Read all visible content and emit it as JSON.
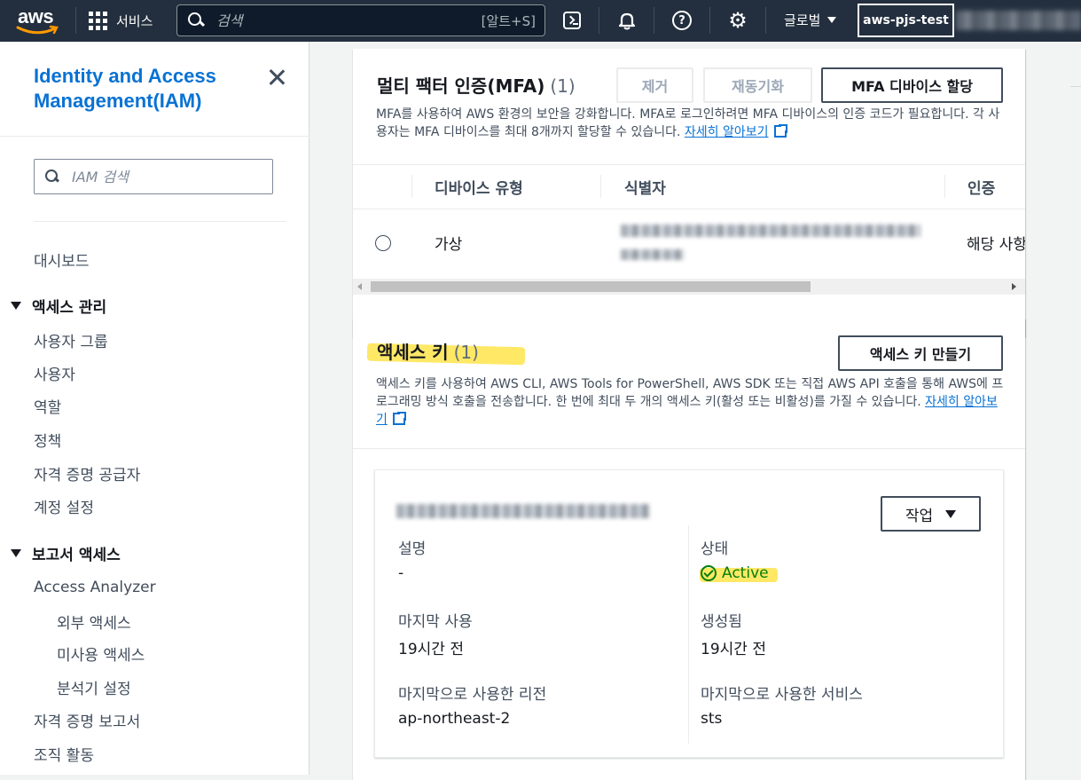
{
  "topbar": {
    "logo": "aws",
    "services_label": "서비스",
    "search_placeholder": "검색",
    "search_shortcut": "[알트+S]",
    "region_label": "글로벌",
    "account_label": "aws-pjs-test"
  },
  "sidebar": {
    "title": "Identity and Access Management(IAM)",
    "search_placeholder": "IAM 검색",
    "dashboard": "대시보드",
    "access_mgmt": {
      "label": "액세스 관리",
      "items": [
        "사용자 그룹",
        "사용자",
        "역할",
        "정책",
        "자격 증명 공급자",
        "계정 설정"
      ]
    },
    "reports": {
      "label": "보고서 액세스",
      "analyzer": "Access Analyzer",
      "analyzer_items": [
        "외부 액세스",
        "미사용 액세스",
        "분석기 설정"
      ],
      "items": [
        "자격 증명 보고서",
        "조직 활동"
      ]
    }
  },
  "mfa": {
    "title": "멀티 팩터 인증(MFA)",
    "count": "(1)",
    "remove_button": "제거",
    "resync_button": "재동기화",
    "assign_button": "MFA 디바이스 할당",
    "description": "MFA를 사용하여 AWS 환경의 보안을 강화합니다. MFA로 로그인하려면 MFA 디바이스의 인증 코드가 필요합니다. 각 사용자는 MFA 디바이스를 최대 8개까지 할당할 수 있습니다.",
    "learn_more": "자세히 알아보기",
    "columns": [
      "디바이스 유형",
      "식별자",
      "인증"
    ],
    "rows": [
      {
        "type": "가상",
        "auth": "해당 사항"
      }
    ]
  },
  "access_keys": {
    "title": "액세스 키",
    "count": "(1)",
    "create_button": "액세스 키 만들기",
    "description": "액세스 키를 사용하여 AWS CLI, AWS Tools for PowerShell, AWS SDK 또는 직접 AWS API 호출을 통해 AWS에 프로그래밍 방식 호출을 전송합니다. 한 번에 최대 두 개의 액세스 키(활성 또는 비활성)를 가질 수 있습니다.",
    "learn_more": "자세히 알아보기",
    "key": {
      "actions_button": "작업",
      "description_label": "설명",
      "description_value": "-",
      "status_label": "상태",
      "status_value": "Active",
      "last_used_label": "마지막 사용",
      "last_used_value": "19시간 전",
      "created_label": "생성됨",
      "created_value": "19시간 전",
      "last_region_label": "마지막으로 사용한 리전",
      "last_region_value": "ap-northeast-2",
      "last_service_label": "마지막으로 사용한 서비스",
      "last_service_value": "sts"
    }
  },
  "colors": {
    "nav_bg": "#232f3e",
    "link": "#0972d3",
    "success": "#037f0c",
    "highlight": "#ffe033"
  }
}
